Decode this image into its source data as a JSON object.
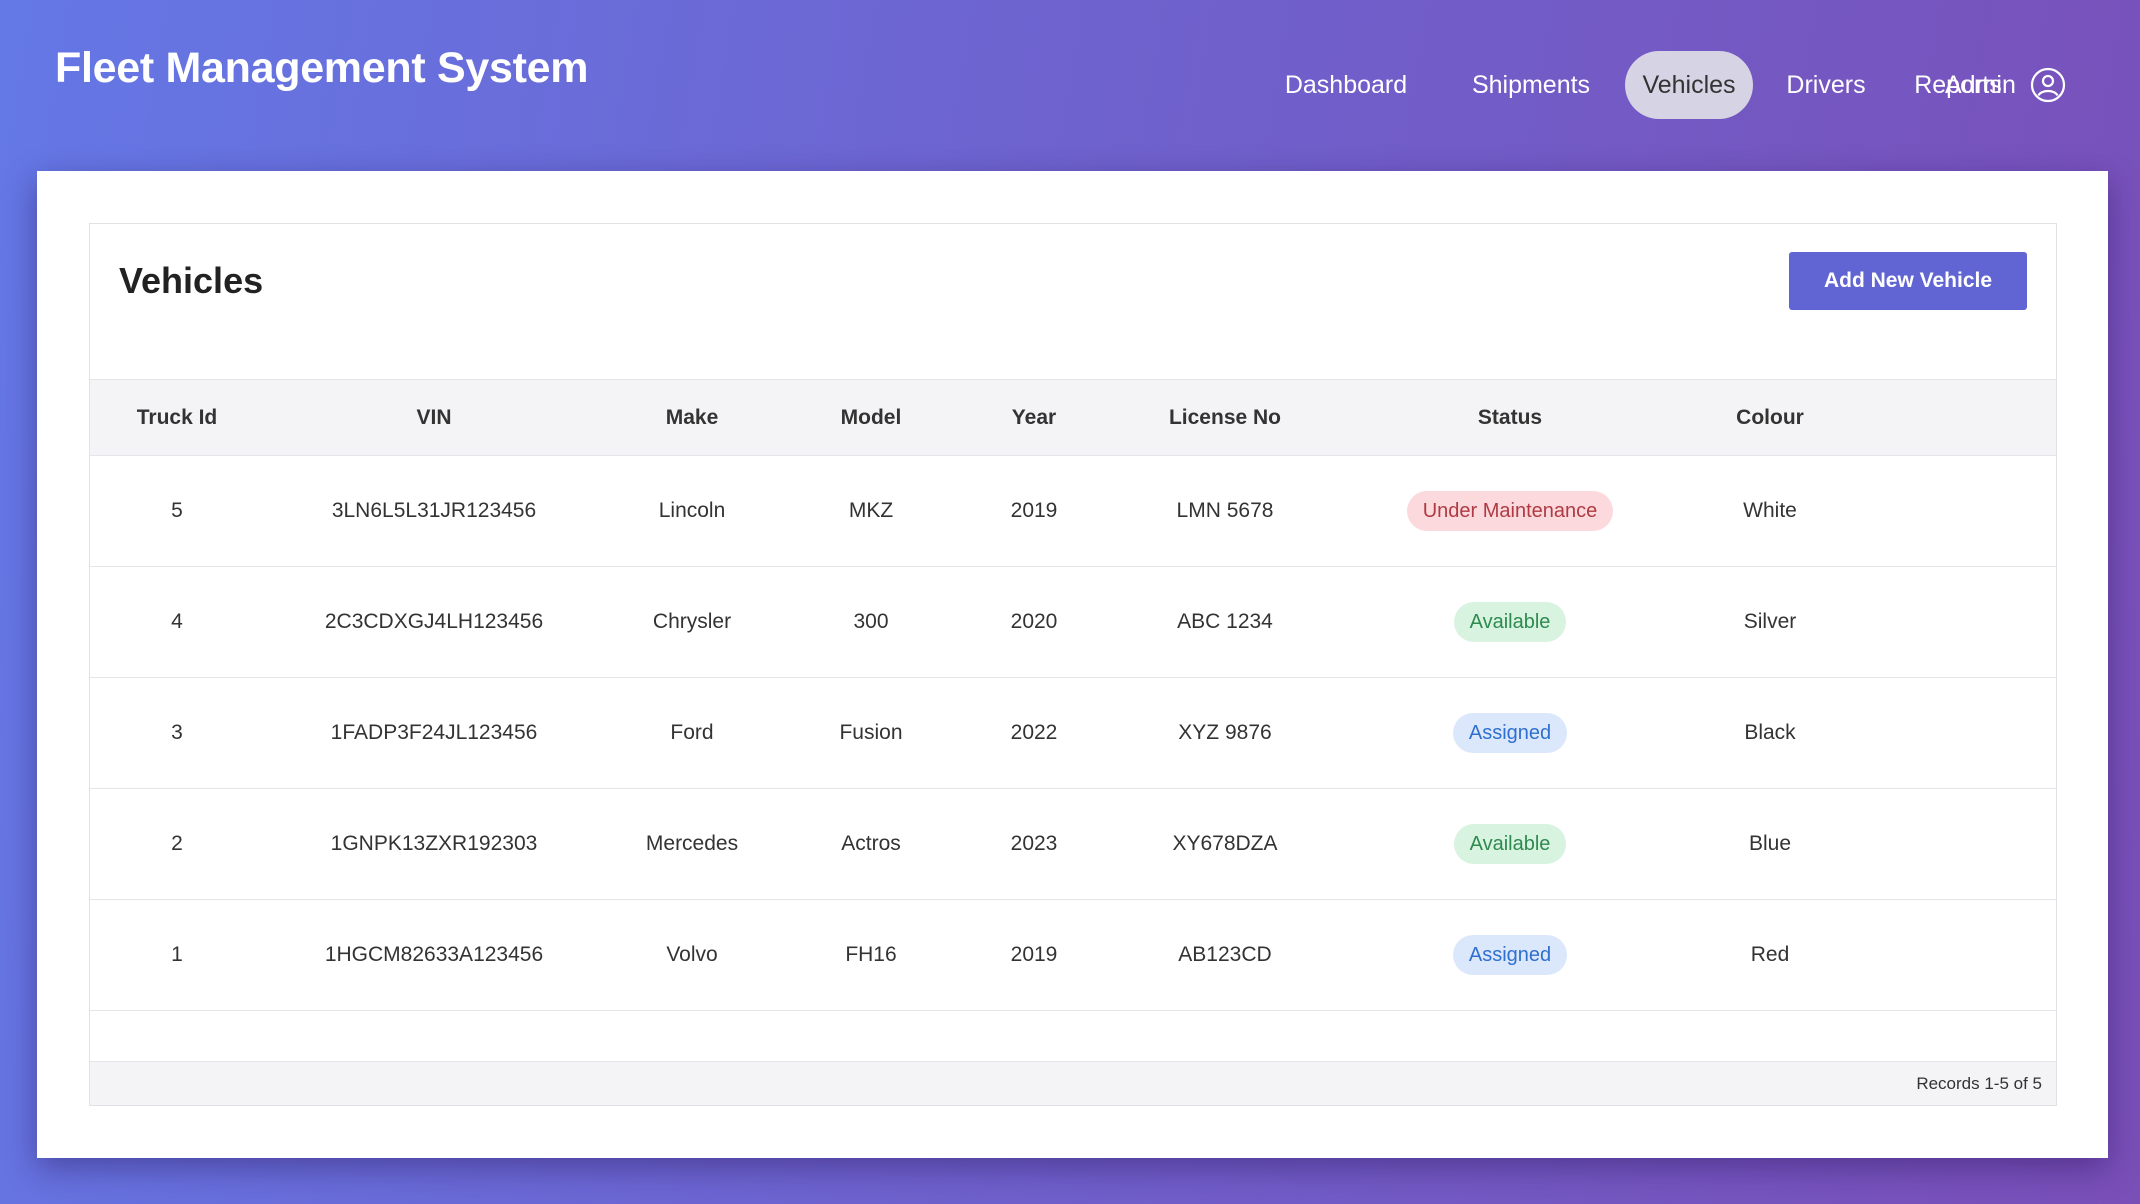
{
  "app": {
    "title": "Fleet Management System"
  },
  "nav": {
    "items": [
      {
        "label": "Dashboard"
      },
      {
        "label": "Shipments"
      },
      {
        "label": "Vehicles",
        "active": true
      },
      {
        "label": "Drivers"
      },
      {
        "label": "Reports"
      }
    ],
    "user_label": "Admin",
    "user_icon": "user-circle-icon"
  },
  "page": {
    "title": "Vehicles",
    "add_button_label": "Add New Vehicle"
  },
  "table": {
    "columns": [
      "Truck Id",
      "VIN",
      "Make",
      "Model",
      "Year",
      "License No",
      "Status",
      "Colour"
    ],
    "rows": [
      {
        "truck_id": "5",
        "vin": "3LN6L5L31JR123456",
        "make": "Lincoln",
        "model": "MKZ",
        "year": "2019",
        "license": "LMN 5678",
        "status": "Under Maintenance",
        "colour": "White"
      },
      {
        "truck_id": "4",
        "vin": "2C3CDXGJ4LH123456",
        "make": "Chrysler",
        "model": "300",
        "year": "2020",
        "license": "ABC 1234",
        "status": "Available",
        "colour": "Silver"
      },
      {
        "truck_id": "3",
        "vin": "1FADP3F24JL123456",
        "make": "Ford",
        "model": "Fusion",
        "year": "2022",
        "license": "XYZ 9876",
        "status": "Assigned",
        "colour": "Black"
      },
      {
        "truck_id": "2",
        "vin": "1GNPK13ZXR192303",
        "make": "Mercedes",
        "model": "Actros",
        "year": "2023",
        "license": "XY678DZA",
        "status": "Available",
        "colour": "Blue"
      },
      {
        "truck_id": "1",
        "vin": "1HGCM82633A123456",
        "make": "Volvo",
        "model": "FH16",
        "year": "2019",
        "license": "AB123CD",
        "status": "Assigned",
        "colour": "Red"
      }
    ],
    "records_text": "Records 1-5 of 5"
  },
  "colors": {
    "accent_button": "#6165d4",
    "status_maintenance": "#b03a43",
    "status_available": "#2e8a4e",
    "status_assigned": "#2f6fcf"
  }
}
